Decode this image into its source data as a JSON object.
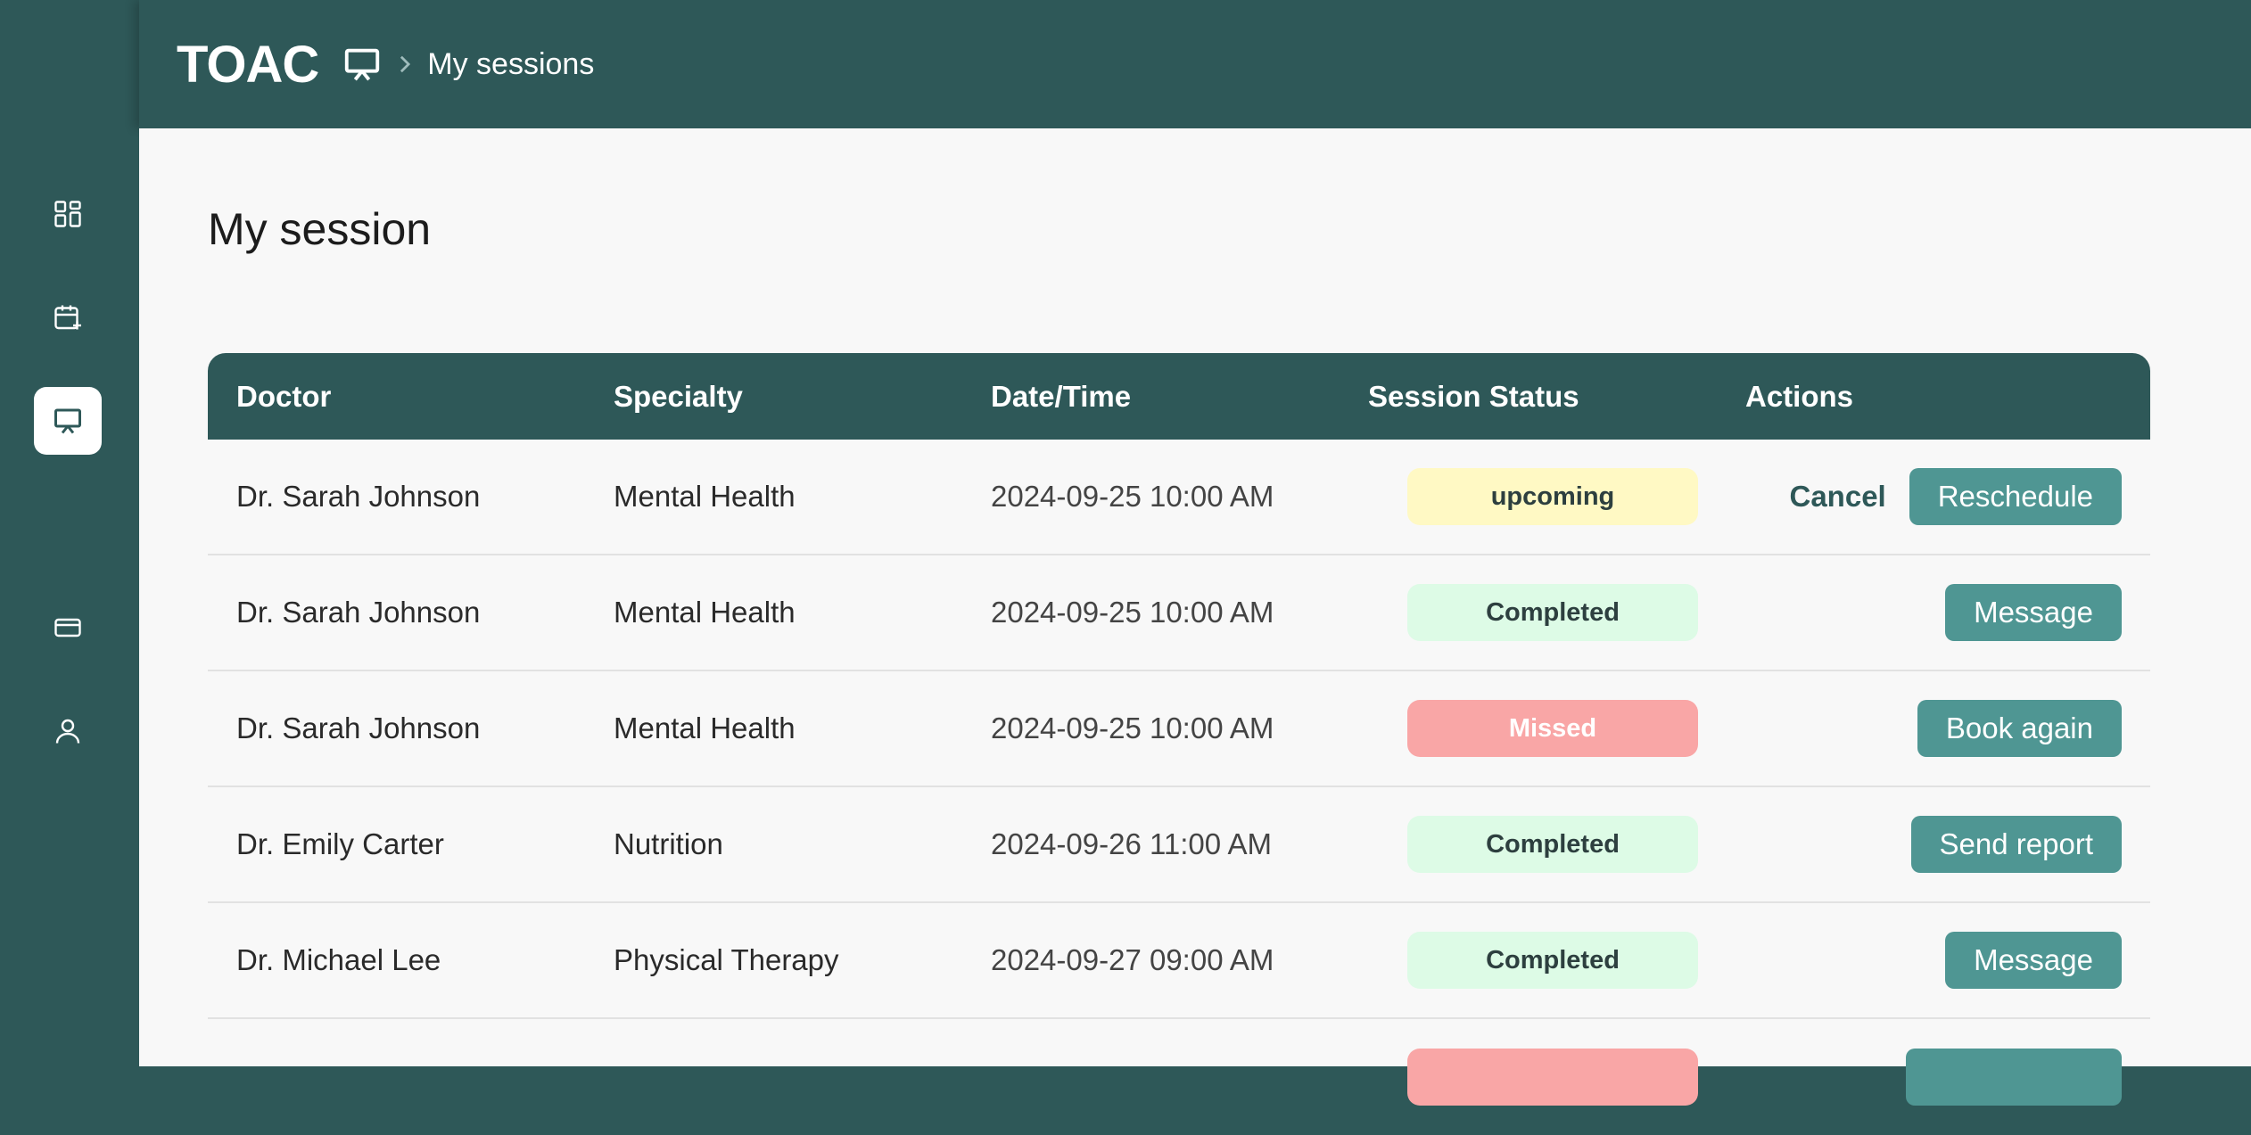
{
  "header": {
    "logo": "TOAC",
    "breadcrumb_icon": "presentation-icon",
    "breadcrumb_current": "My sessions"
  },
  "sidebar": {
    "items": [
      {
        "icon": "dashboard-grid-icon"
      },
      {
        "icon": "calendar-plus-icon"
      },
      {
        "icon": "presentation-icon",
        "active": true
      },
      {
        "icon": "credit-card-icon"
      },
      {
        "icon": "user-icon"
      }
    ]
  },
  "page": {
    "title": "My session"
  },
  "table": {
    "headers": [
      "Doctor",
      "Specialty",
      "Date/Time",
      "Session Status",
      "Actions"
    ],
    "rows": [
      {
        "doctor": "Dr. Sarah Johnson",
        "specialty": "Mental Health",
        "datetime": "2024-09-25 10:00 AM",
        "status": "upcoming",
        "secondary_action": "Cancel",
        "primary_action": "Reschedule"
      },
      {
        "doctor": "Dr. Sarah Johnson",
        "specialty": "Mental Health",
        "datetime": "2024-09-25 10:00 AM",
        "status": "Completed",
        "primary_action": "Message"
      },
      {
        "doctor": "Dr. Sarah Johnson",
        "specialty": "Mental Health",
        "datetime": "2024-09-25 10:00 AM",
        "status": "Missed",
        "primary_action": "Book again"
      },
      {
        "doctor": "Dr. Emily Carter",
        "specialty": "Nutrition",
        "datetime": "2024-09-26 11:00 AM",
        "status": "Completed",
        "primary_action": "Send report"
      },
      {
        "doctor": "Dr. Michael Lee",
        "specialty": "Physical Therapy",
        "datetime": "2024-09-27 09:00 AM",
        "status": "Completed",
        "primary_action": "Message"
      }
    ]
  },
  "colors": {
    "brand": "#2e5858",
    "button": "#4f9693",
    "status_upcoming": "#fff9c4",
    "status_completed": "#ddfbe6",
    "status_missed": "#f9a6a6"
  }
}
